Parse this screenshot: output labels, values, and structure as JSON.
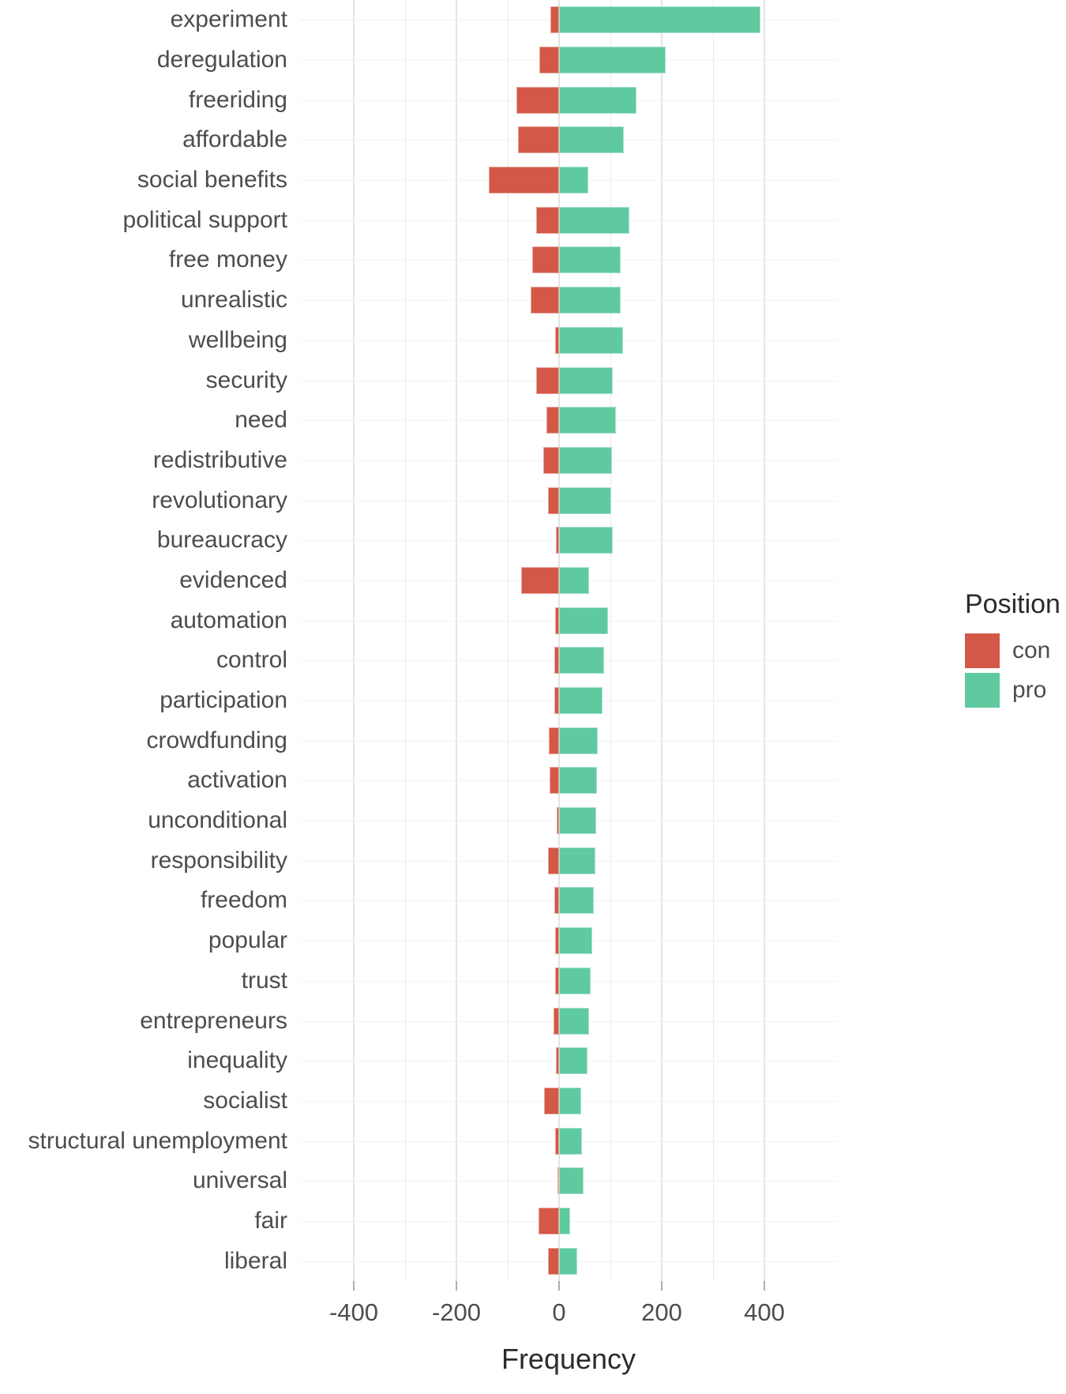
{
  "chart_data": {
    "type": "bar",
    "orientation": "horizontal",
    "subtype": "diverging-stacked",
    "title": "",
    "xlabel": "Frequency",
    "ylabel": "",
    "xlim": [
      -460,
      460
    ],
    "xticks": [
      -400,
      -200,
      0,
      200,
      400
    ],
    "xticklabels": [
      "-400",
      "-200",
      "0",
      "200",
      "400"
    ],
    "grid": true,
    "legend": {
      "title": "Position",
      "position": "right",
      "entries": [
        {
          "name": "con",
          "color": "#d35847"
        },
        {
          "name": "pro",
          "color": "#5fc9a0"
        }
      ]
    },
    "categories": [
      "experiment",
      "deregulation",
      "freeriding",
      "affordable",
      "social benefits",
      "political support",
      "free money",
      "unrealistic",
      "wellbeing",
      "security",
      "need",
      "redistributive",
      "revolutionary",
      "bureaucracy",
      "evidenced",
      "automation",
      "control",
      "participation",
      "crowdfunding",
      "activation",
      "unconditional",
      "responsibility",
      "freedom",
      "popular",
      "trust",
      "entrepreneurs",
      "inequality",
      "socialist",
      "structural unemployment",
      "universal",
      "fair",
      "liberal"
    ],
    "series": [
      {
        "name": "con",
        "color": "#d35847",
        "values": [
          -17,
          -38,
          -83,
          -80,
          -137,
          -45,
          -53,
          -55,
          -7,
          -44,
          -24,
          -31,
          -22,
          -6,
          -74,
          -8,
          -9,
          -10,
          -20,
          -18,
          -5,
          -22,
          -9,
          -8,
          -8,
          -11,
          -6,
          -30,
          -7,
          -3,
          -40,
          -22
        ]
      },
      {
        "name": "pro",
        "color": "#5fc9a0",
        "values": [
          392,
          208,
          150,
          126,
          57,
          137,
          120,
          120,
          125,
          105,
          110,
          103,
          101,
          104,
          59,
          95,
          88,
          85,
          75,
          74,
          72,
          70,
          68,
          65,
          62,
          58,
          55,
          43,
          44,
          48,
          22,
          36
        ]
      }
    ]
  },
  "axis": {
    "x_title": "Frequency"
  }
}
